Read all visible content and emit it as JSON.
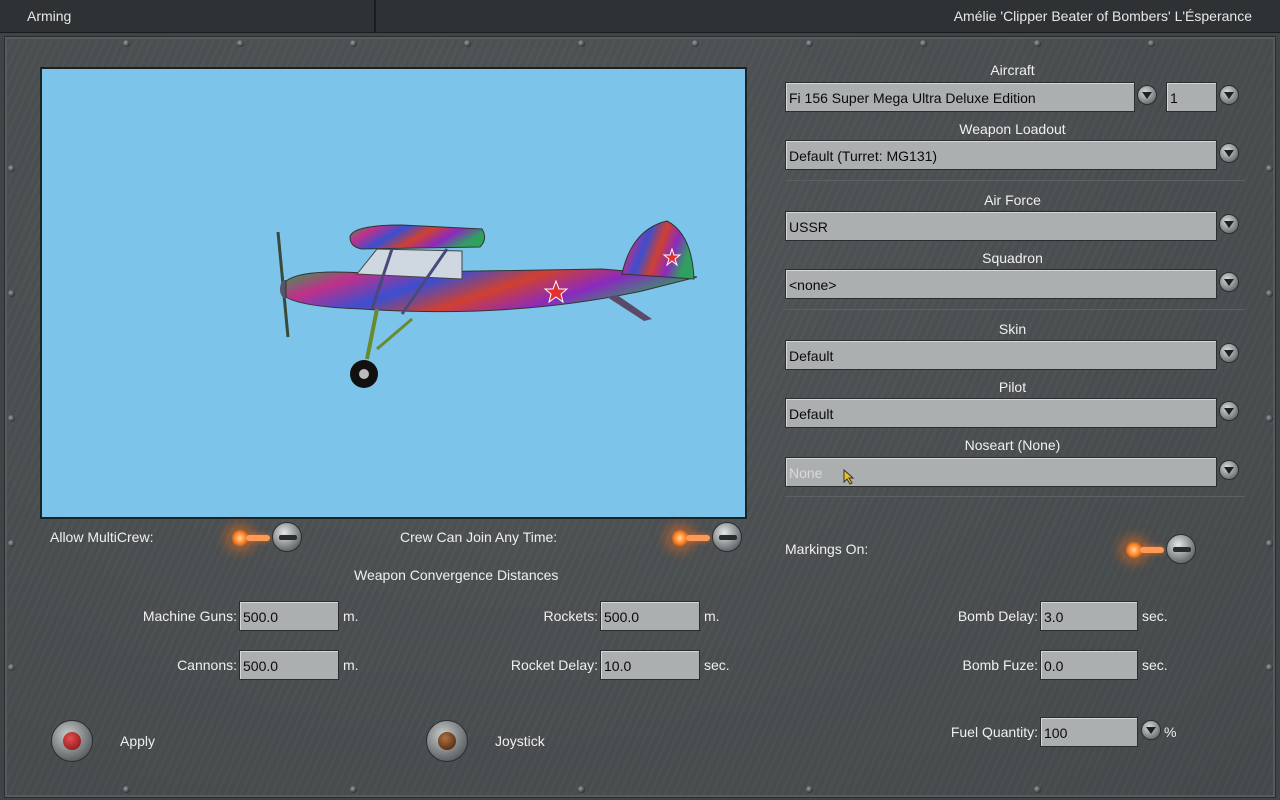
{
  "titlebar": {
    "left": "Arming",
    "right": "Amélie 'Clipper Beater of Bombers' L'Ésperance"
  },
  "aircraft": {
    "label": "Aircraft",
    "value": "Fi 156 Super Mega Ultra Deluxe Edition",
    "count": "1"
  },
  "weapon_loadout": {
    "label": "Weapon Loadout",
    "value": "Default (Turret: MG131)"
  },
  "air_force": {
    "label": "Air Force",
    "value": "USSR"
  },
  "squadron": {
    "label": "Squadron",
    "value": "<none>"
  },
  "skin": {
    "label": "Skin",
    "value": "Default"
  },
  "pilot": {
    "label": "Pilot",
    "value": "Default"
  },
  "noseart": {
    "label": "Noseart (None)",
    "placeholder": "None"
  },
  "toggles": {
    "allow_multicrew": "Allow MultiCrew:",
    "crew_join": "Crew Can Join Any Time:",
    "markings_on": "Markings On:"
  },
  "convergence": {
    "heading": "Weapon Convergence Distances",
    "machine_guns": {
      "label": "Machine Guns:",
      "value": "500.0",
      "unit": "m."
    },
    "cannons": {
      "label": "Cannons:",
      "value": "500.0",
      "unit": "m."
    },
    "rockets": {
      "label": "Rockets:",
      "value": "500.0",
      "unit": "m."
    },
    "rocket_delay": {
      "label": "Rocket Delay:",
      "value": "10.0",
      "unit": "sec."
    },
    "bomb_delay": {
      "label": "Bomb Delay:",
      "value": "3.0",
      "unit": "sec."
    },
    "bomb_fuze": {
      "label": "Bomb Fuze:",
      "value": "0.0",
      "unit": "sec."
    }
  },
  "fuel": {
    "label": "Fuel Quantity:",
    "value": "100",
    "unit": "%"
  },
  "buttons": {
    "apply": "Apply",
    "joystick": "Joystick"
  },
  "colors": {
    "preview_sky": "#7cc4ea",
    "lamp_on": "#ff7a1a",
    "apply_core": "#b01818",
    "joystick_core": "#6a3a10"
  }
}
